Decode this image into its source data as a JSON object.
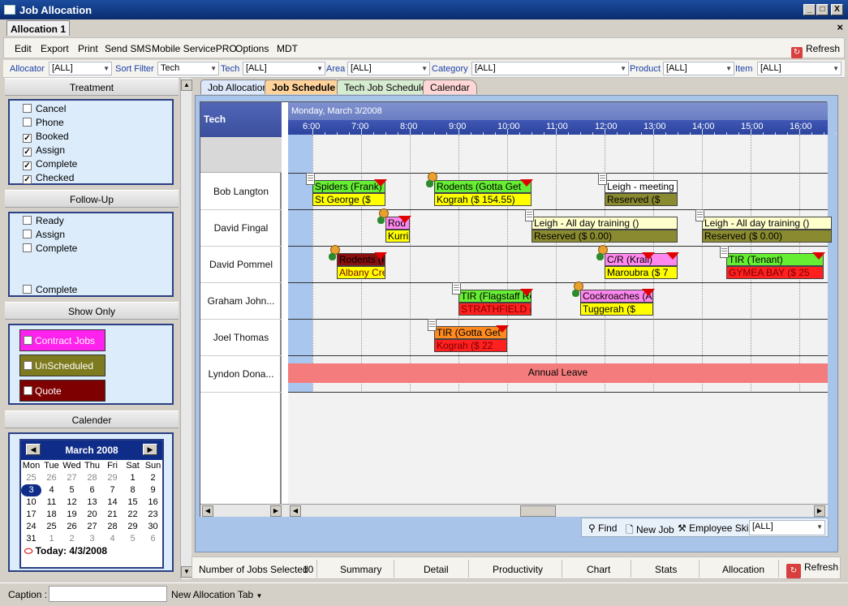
{
  "window": {
    "title": "Job Allocation",
    "doc_tab": "Allocation 1",
    "min": "_",
    "max": "□",
    "close": "X",
    "doc_close": "×"
  },
  "menu": {
    "items": [
      "Edit",
      "Export",
      "Print",
      "Send SMS",
      "Mobile ServicePRO",
      "Options",
      "MDT"
    ],
    "refresh": "Refresh"
  },
  "filters": [
    {
      "label": "Allocator",
      "value": "[ALL]"
    },
    {
      "label": "Sort Filter",
      "value": "Tech"
    },
    {
      "label": "Tech",
      "value": "[ALL]"
    },
    {
      "label": "Area",
      "value": "[ALL]"
    },
    {
      "label": "Category",
      "value": "[ALL]"
    },
    {
      "label": "Product",
      "value": "[ALL]"
    },
    {
      "label": "Item",
      "value": "[ALL]"
    }
  ],
  "treatment": {
    "title": "Treatment",
    "items": [
      {
        "label": "Cancel",
        "checked": false
      },
      {
        "label": "Phone",
        "checked": false
      },
      {
        "label": "Booked",
        "checked": true
      },
      {
        "label": "Assign",
        "checked": true
      },
      {
        "label": "Complete",
        "checked": true
      },
      {
        "label": "Checked",
        "checked": true
      }
    ]
  },
  "followup": {
    "title": "Follow-Up",
    "items": [
      {
        "label": "Ready",
        "checked": false
      },
      {
        "label": "Assign",
        "checked": false
      },
      {
        "label": "Complete",
        "checked": false
      }
    ],
    "extra": {
      "label": "Complete",
      "checked": false
    }
  },
  "showonly": {
    "title": "Show Only",
    "items": [
      {
        "label": "Contract Jobs",
        "bg": "#ff22ee",
        "fg": "#ffffff"
      },
      {
        "label": "UnScheduled",
        "bg": "#7e7a1e",
        "fg": "#ffffff"
      },
      {
        "label": "Quote",
        "bg": "#7e0000",
        "fg": "#ffffff"
      }
    ]
  },
  "calendar": {
    "title": "Calender",
    "month": "March 2008",
    "prev": "◀",
    "next": "▶",
    "dow": [
      "Mon",
      "Tue",
      "Wed",
      "Thu",
      "Fri",
      "Sat",
      "Sun"
    ],
    "days": [
      "25",
      "26",
      "27",
      "28",
      "29",
      "1",
      "2",
      "3",
      "4",
      "5",
      "6",
      "7",
      "8",
      "9",
      "10",
      "11",
      "12",
      "13",
      "14",
      "15",
      "16",
      "17",
      "18",
      "19",
      "20",
      "21",
      "22",
      "23",
      "24",
      "25",
      "26",
      "27",
      "28",
      "29",
      "30",
      "31",
      "1",
      "2",
      "3",
      "4",
      "5",
      "6"
    ],
    "today": "Today: 4/3/2008"
  },
  "tabs": [
    "Job Allocation",
    "Job Schedule",
    "Tech Job Schedule",
    "Calendar"
  ],
  "schedule": {
    "date": "Monday, March 3/2008",
    "tech_header": "Tech",
    "hours": [
      "6:00",
      "7:00",
      "8:00",
      "9:00",
      "10:00",
      "11:00",
      "12:00",
      "13:00",
      "14:00",
      "15:00",
      "16:00"
    ],
    "techs": [
      "Bob Langton",
      "David Fingal",
      "David Pommel",
      "Graham John...",
      "Joel Thomas",
      "Lyndon Dona..."
    ],
    "jobs": [
      {
        "top": "Spiders (Frank)",
        "bottom": "St George ($",
        "tc": "#66ee33",
        "bc": "#ffff00"
      },
      {
        "top": "Rodents (Gotta Get",
        "bottom": "Kograh ($    154.55)",
        "tc": "#66ee33",
        "bc": "#ffff00"
      },
      {
        "top": "Leigh - meeting",
        "bottom": "Reserved ($",
        "tc": "#ffffff",
        "bc": "#8a8a30"
      },
      {
        "top": "Rod",
        "bottom": "Kurri",
        "tc": "#ff88ee",
        "bc": "#ffff00"
      },
      {
        "top": "Leigh - All day training ()",
        "bottom": "Reserved ($       0.00)",
        "tc": "#ffffcc",
        "bc": "#8a8a30"
      },
      {
        "top": "Leigh - All day training ()",
        "bottom": "Reserved ($       0.00)",
        "tc": "#ffffcc",
        "bc": "#8a8a30"
      },
      {
        "top": "Rodents (F",
        "bottom": "Albany Cre",
        "tc": "#8a1010",
        "bc": "#ffff00"
      },
      {
        "top": "C/R (Krall)",
        "bottom": "Maroubra ($     7",
        "tc": "#ff88ee",
        "bc": "#ffff00"
      },
      {
        "top": "TIR (Tenant)",
        "bottom": "GYMEA BAY ($    25",
        "tc": "#66ee33",
        "bc": "#ff2020"
      },
      {
        "top": "TIR (Flagstaff Re",
        "bottom": "STRATHFIELD (",
        "tc": "#66ee33",
        "bc": "#ff2020"
      },
      {
        "top": "Cockroaches (A",
        "bottom": "Tuggerah ($",
        "tc": "#ff88ee",
        "bc": "#ffff00"
      },
      {
        "top": "TIR (Gotta Get",
        "bottom": "Kograh ($     22",
        "tc": "#ff8a20",
        "bc": "#ff2020"
      }
    ],
    "leave": "Annual Leave"
  },
  "findbar": {
    "find": "Find",
    "newjob": "New Job",
    "skill": "Employee Skill",
    "skill_value": "[ALL]"
  },
  "bottom": {
    "jobs_selected_label": "Number of Jobs Selected",
    "jobs_selected": "10",
    "items": [
      "Summary",
      "Detail",
      "Productivity",
      "Chart",
      "Stats",
      "Allocation"
    ],
    "refresh": "Refresh"
  },
  "status": {
    "caption_label": "Caption :",
    "caption_value": "",
    "newtab": "New Allocation Tab"
  }
}
